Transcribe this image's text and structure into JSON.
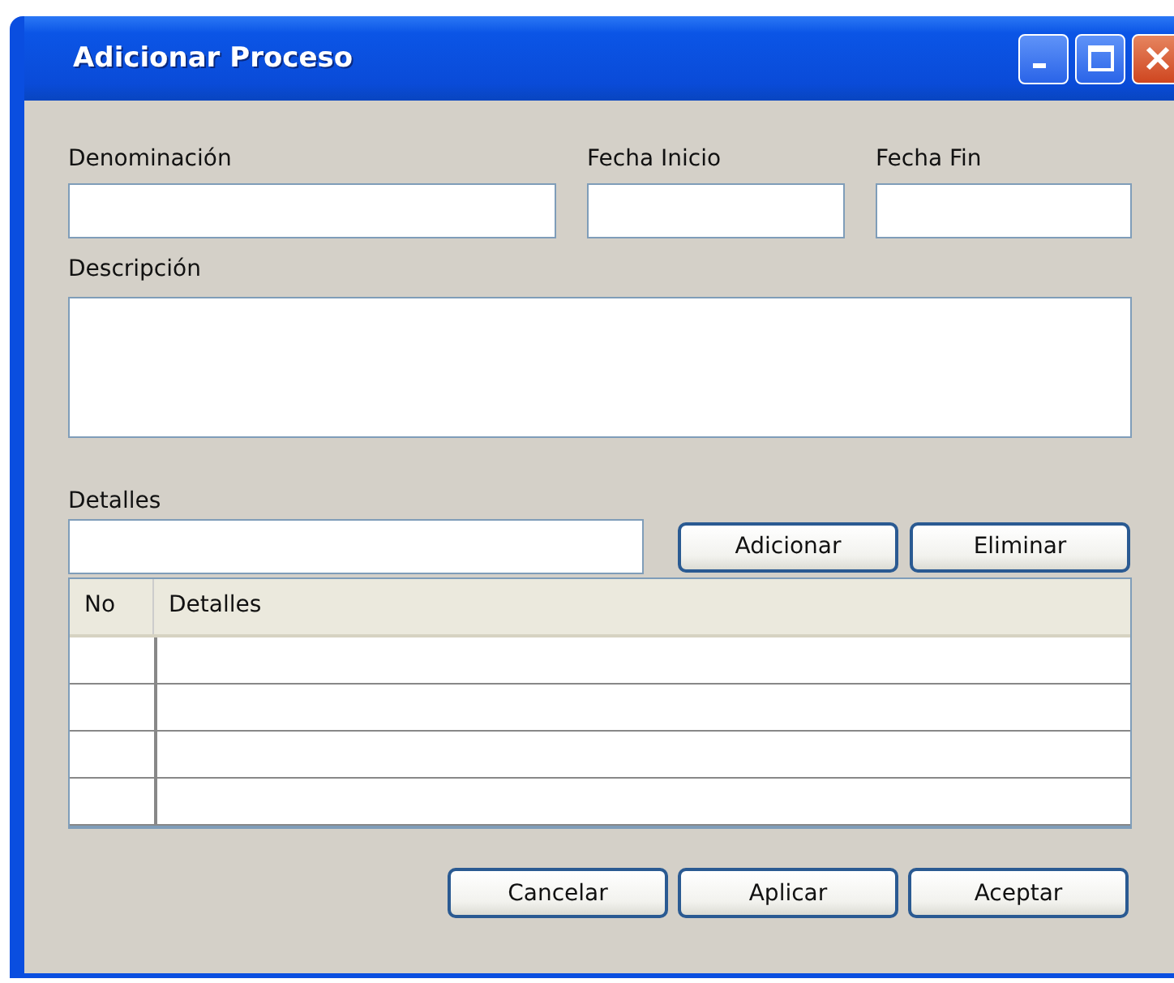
{
  "window": {
    "title": "Adicionar Proceso"
  },
  "fields": [
    {
      "label": "Denominación"
    },
    {
      "label": "Fecha Inicio"
    },
    {
      "label": "Fecha Fin"
    }
  ],
  "description": {
    "label": "Descripción"
  },
  "details": {
    "label": "Detalles",
    "buttons": [
      "Adicionar",
      "Eliminar"
    ]
  },
  "table": {
    "columns": [
      "No",
      "Detalles"
    ]
  },
  "buttons": [
    "Cancelar",
    "Aplicar",
    "Aceptar"
  ]
}
